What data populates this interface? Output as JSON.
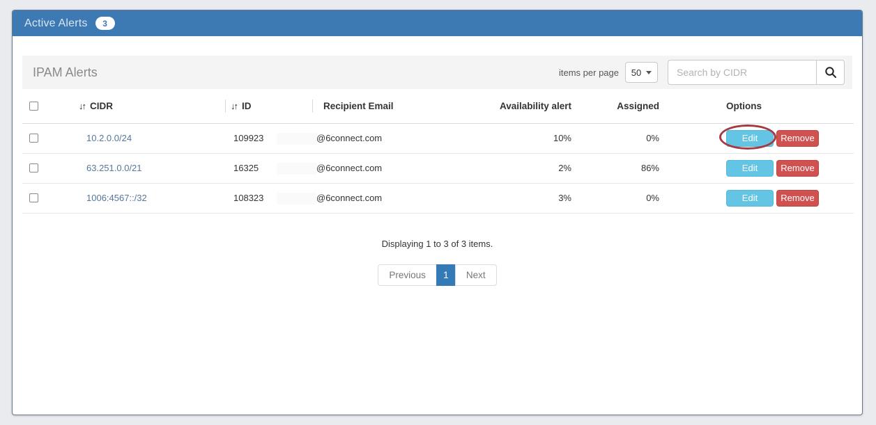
{
  "window": {
    "title": "Active Alerts",
    "badge_count": "3"
  },
  "panel": {
    "title": "IPAM Alerts",
    "items_per_page_label": "items per page",
    "items_per_page_value": "50",
    "search_placeholder": "Search by CIDR"
  },
  "table": {
    "sort_icon": "↓↑",
    "columns": [
      "CIDR",
      "ID",
      "Recipient Email",
      "Availability alert",
      "Assigned",
      "Options"
    ],
    "actions": {
      "edit": "Edit",
      "remove": "Remove"
    },
    "rows": [
      {
        "cidr": "10.2.0.0/24",
        "id": "109923",
        "email": "@6connect.com",
        "availability_alert": "10%",
        "assigned": "0%"
      },
      {
        "cidr": "63.251.0.0/21",
        "id": "16325",
        "email": "@6connect.com",
        "availability_alert": "2%",
        "assigned": "86%"
      },
      {
        "cidr": "1006:4567::/32",
        "id": "108323",
        "email": "@6connect.com",
        "availability_alert": "3%",
        "assigned": "0%"
      }
    ]
  },
  "footer": {
    "summary": "Displaying 1 to 3 of 3 items.",
    "pagination": {
      "previous": "Previous",
      "current_page": "1",
      "next": "Next"
    }
  },
  "colors": {
    "header_blue": "#3d79b3",
    "edit_button": "#63c4e4",
    "remove_button": "#cf5150",
    "active_page": "#337ab7",
    "link": "#55779c",
    "annotation_red": "#a63a42"
  }
}
